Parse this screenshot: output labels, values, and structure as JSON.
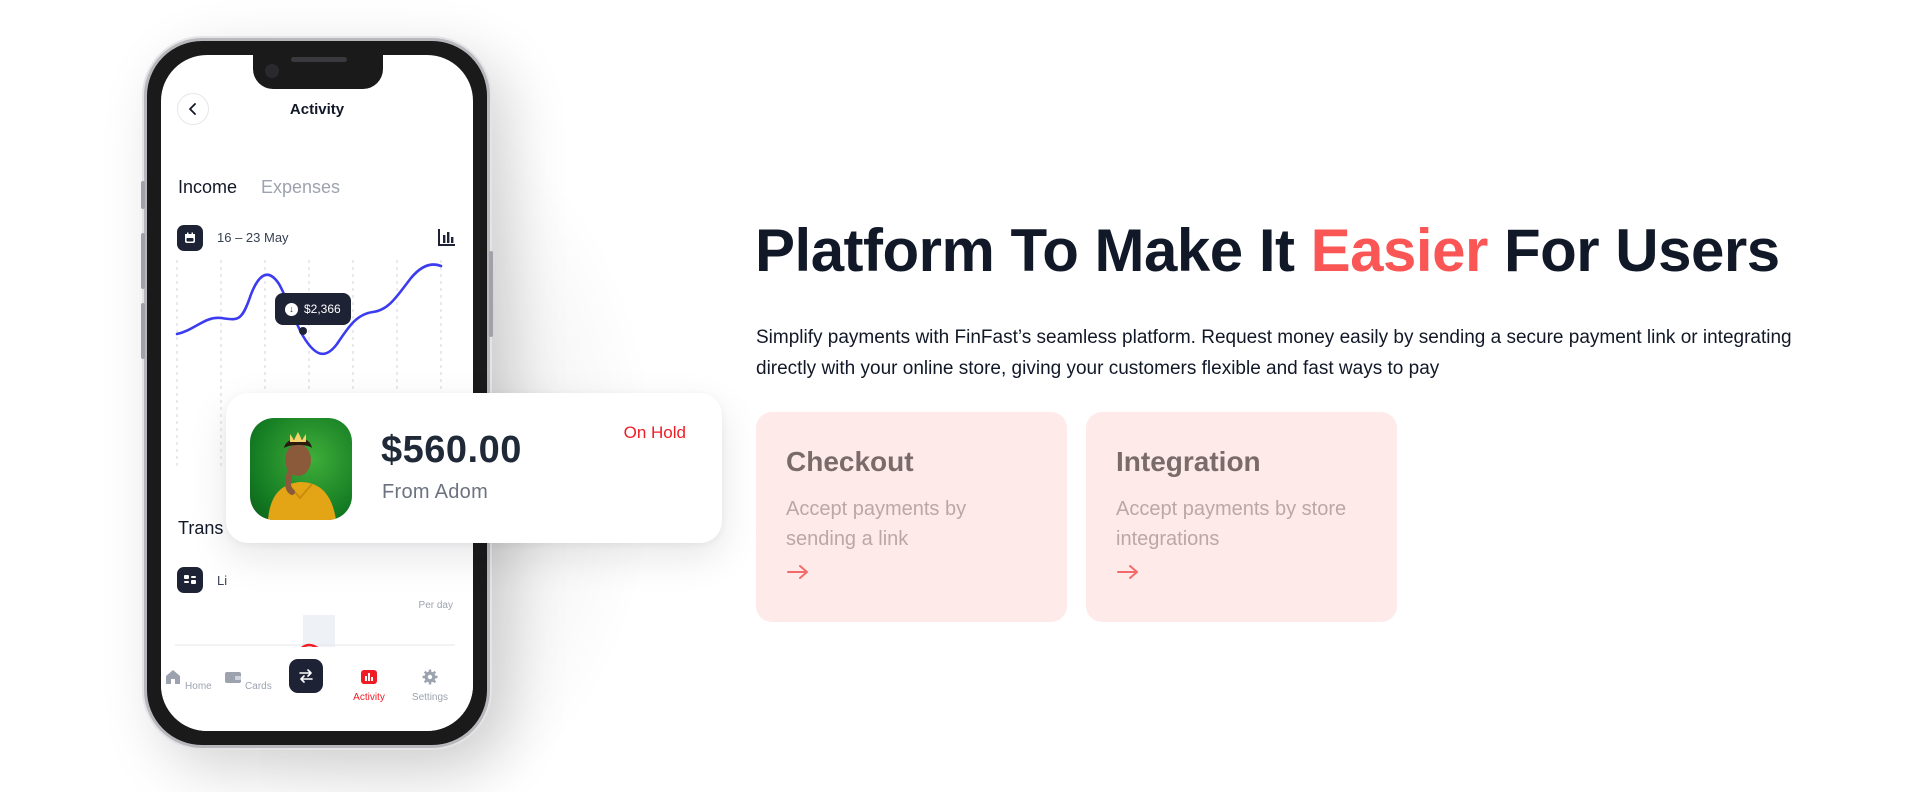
{
  "phone": {
    "screen_title": "Activity",
    "tabs": [
      {
        "label": "Income",
        "active": true
      },
      {
        "label": "Expenses",
        "active": false
      }
    ],
    "date_range": "16 – 23 May",
    "tooltip_value": "$2,366",
    "transactions_title": "Trans",
    "list_label": "Li",
    "per_day_label": "Per day",
    "nav": [
      {
        "label": "Home",
        "icon": "home-icon",
        "active": false
      },
      {
        "label": "Cards",
        "icon": "wallet-icon",
        "active": false
      },
      {
        "label": "",
        "icon": "transfer-icon",
        "active": false
      },
      {
        "label": "Activity",
        "icon": "chart-bar-icon",
        "active": true
      },
      {
        "label": "Settings",
        "icon": "gear-icon",
        "active": false
      }
    ]
  },
  "payment_card": {
    "amount": "$560.00",
    "from": "From Adom",
    "status": "On Hold",
    "status_color": "#ef1c25"
  },
  "hero": {
    "headline_before": "Platform To Make It ",
    "headline_accent": "Easier",
    "headline_after": " For Users",
    "accent_color": "#fa5656",
    "description": "Simplify payments with FinFast’s seamless platform. Request money easily by sending a secure payment link or integrating directly with your online store, giving your customers flexible and fast ways to pay"
  },
  "features": [
    {
      "title": "Checkout",
      "description": "Accept payments by sending a link",
      "icon": "arrow-right-icon"
    },
    {
      "title": "Integration",
      "description": "Accept payments by store integrations",
      "icon": "arrow-right-icon"
    }
  ]
}
